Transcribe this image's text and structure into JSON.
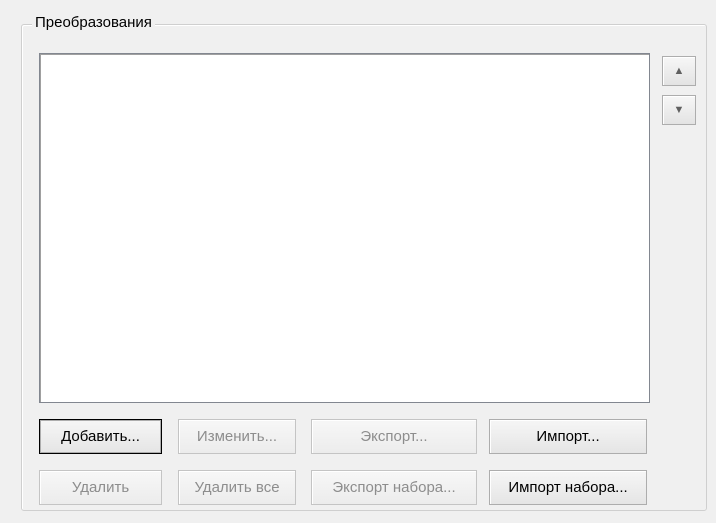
{
  "group": {
    "title": "Преобразования"
  },
  "listbox": {
    "items": []
  },
  "reorder": {
    "up_icon": "▲",
    "down_icon": "▼"
  },
  "buttons": {
    "add": "Добавить...",
    "edit": "Изменить...",
    "export": "Экспорт...",
    "import": "Импорт...",
    "delete": "Удалить",
    "delete_all": "Удалить все",
    "export_set": "Экспорт набора...",
    "import_set": "Импорт набора..."
  }
}
